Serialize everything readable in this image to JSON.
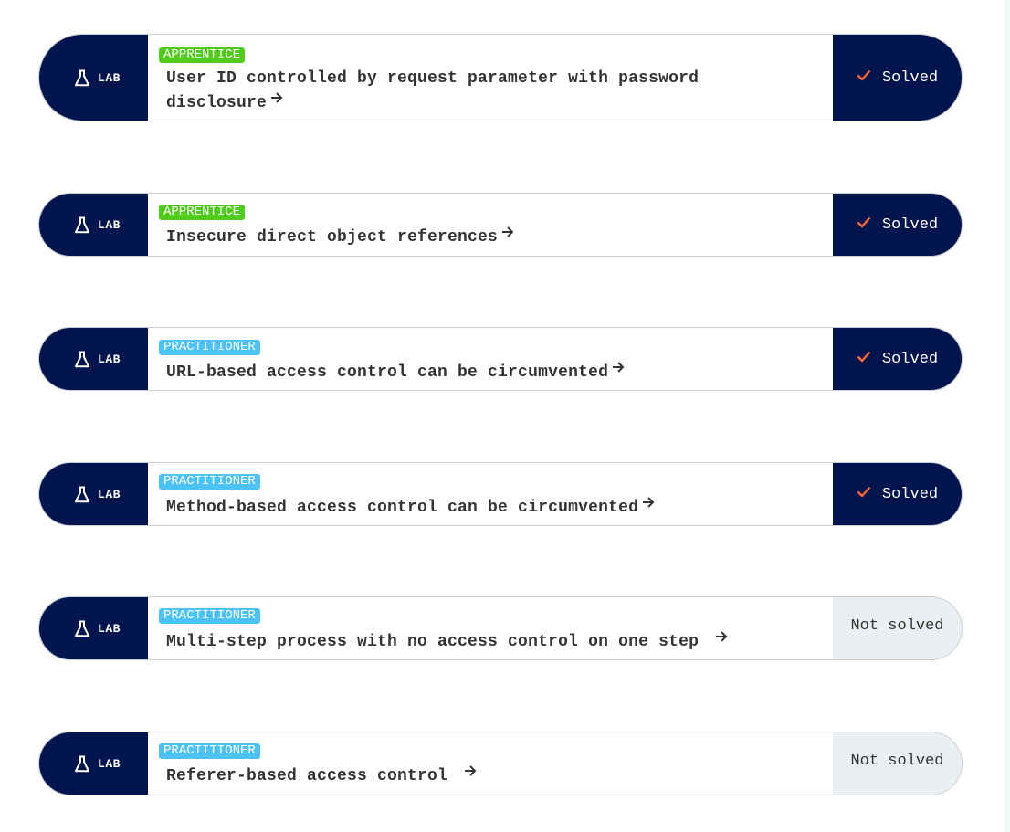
{
  "labs": [
    {
      "tag": "LAB",
      "level": "APPRENTICE",
      "title": "User ID controlled by request parameter with password disclosure",
      "status": "Solved"
    },
    {
      "tag": "LAB",
      "level": "APPRENTICE",
      "title": "Insecure direct object references",
      "status": "Solved"
    },
    {
      "tag": "LAB",
      "level": "PRACTITIONER",
      "title": "URL-based access control can be circumvented",
      "status": "Solved"
    },
    {
      "tag": "LAB",
      "level": "PRACTITIONER",
      "title": "Method-based access control can be circumvented",
      "status": "Solved"
    },
    {
      "tag": "LAB",
      "level": "PRACTITIONER",
      "title": "Multi-step process with no access control on one step",
      "status": "Not solved"
    },
    {
      "tag": "LAB",
      "level": "PRACTITIONER",
      "title": "Referer-based access control",
      "status": "Not solved"
    }
  ],
  "icons": {
    "lab": "flask-icon",
    "link": "arrow-right-icon",
    "solved": "checkmark-icon"
  },
  "colors": {
    "navy": "#00144d",
    "apprentice": "#4fcc1a",
    "practitioner": "#4cc2f7",
    "check": "#ff6633",
    "not_solved_bg": "#eaeff1"
  }
}
